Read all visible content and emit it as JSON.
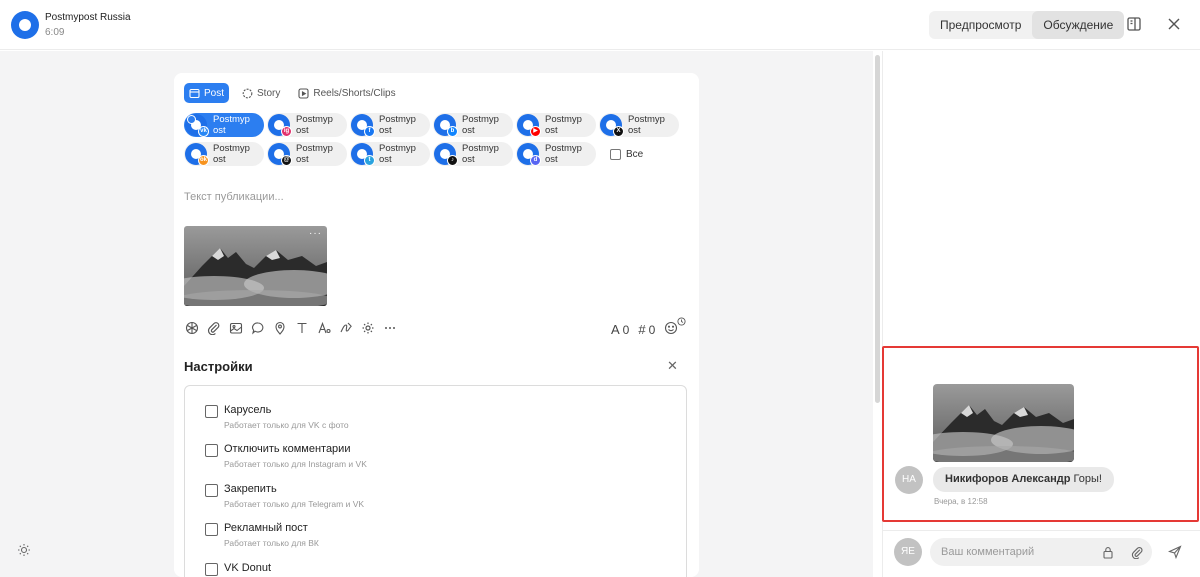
{
  "header": {
    "account_name": "Postmypost Russia",
    "time": "6:09",
    "tabs": [
      {
        "label": "Предпросмотр",
        "active": false
      },
      {
        "label": "Обсуждение",
        "active": true
      }
    ]
  },
  "editor": {
    "post_types": [
      {
        "label": "Post",
        "icon": "post-icon",
        "active": true
      },
      {
        "label": "Story",
        "icon": "story-icon",
        "active": false
      },
      {
        "label": "Reels/Shorts/Clips",
        "icon": "reels-icon",
        "active": false
      }
    ],
    "channels": [
      {
        "line1": "Postmyp",
        "line2": "ost",
        "network": "vk-icon",
        "color": "#2787f5",
        "glyph": "vk",
        "selected": true
      },
      {
        "line1": "Postmyp",
        "line2": "ost",
        "network": "instagram-icon",
        "color": "#e1306c",
        "glyph": "ig",
        "selected": false
      },
      {
        "line1": "Postmyp",
        "line2": "ost",
        "network": "facebook-icon",
        "color": "#1877f2",
        "glyph": "f",
        "selected": false
      },
      {
        "line1": "Postmyp",
        "line2": "ost",
        "network": "bluesky-icon",
        "color": "#1185fe",
        "glyph": "b",
        "selected": false
      },
      {
        "line1": "Postmyp",
        "line2": "ost",
        "network": "youtube-icon",
        "color": "#ff0000",
        "glyph": "▶",
        "selected": false
      },
      {
        "line1": "Postmyp",
        "line2": "ost",
        "network": "x-icon",
        "color": "#111111",
        "glyph": "X",
        "selected": false
      },
      {
        "line1": "Postmyp",
        "line2": "ost",
        "network": "ok-icon",
        "color": "#f7931e",
        "glyph": "ok",
        "selected": false
      },
      {
        "line1": "Postmyp",
        "line2": "ost",
        "network": "threads-icon",
        "color": "#111111",
        "glyph": "@",
        "selected": false
      },
      {
        "line1": "Postmyp",
        "line2": "ost",
        "network": "telegram-icon",
        "color": "#2aa3df",
        "glyph": "t",
        "selected": false
      },
      {
        "line1": "Postmyp",
        "line2": "ost",
        "network": "tiktok-icon",
        "color": "#111111",
        "glyph": "♪",
        "selected": false
      },
      {
        "line1": "Postmyp",
        "line2": "ost",
        "network": "discord-icon",
        "color": "#5865f2",
        "glyph": "d",
        "selected": false
      }
    ],
    "all_label": "Все",
    "text_placeholder": "Текст публикации...",
    "counter_chars": "0",
    "counter_tags": "0"
  },
  "settings": {
    "title": "Настройки",
    "options": [
      {
        "label": "Карусель",
        "hint": "Работает только для VK с фото"
      },
      {
        "label": "Отключить комментарии",
        "hint": "Работает только для Instagram и VK"
      },
      {
        "label": "Закрепить",
        "hint": "Работает только для Telegram и VK"
      },
      {
        "label": "Рекламный пост",
        "hint": "Работает только для ВК"
      },
      {
        "label": "VK Donut",
        "hint": ""
      }
    ]
  },
  "discussion": {
    "comment": {
      "avatar": "НА",
      "author": "Никифоров Александр",
      "text": "Горы!",
      "time": "Вчера, в 12:58"
    },
    "my_avatar": "ЯЕ",
    "input_placeholder": "Ваш комментарий"
  },
  "colors": {
    "accent": "#2c7ef0",
    "highlight": "#e53935"
  }
}
